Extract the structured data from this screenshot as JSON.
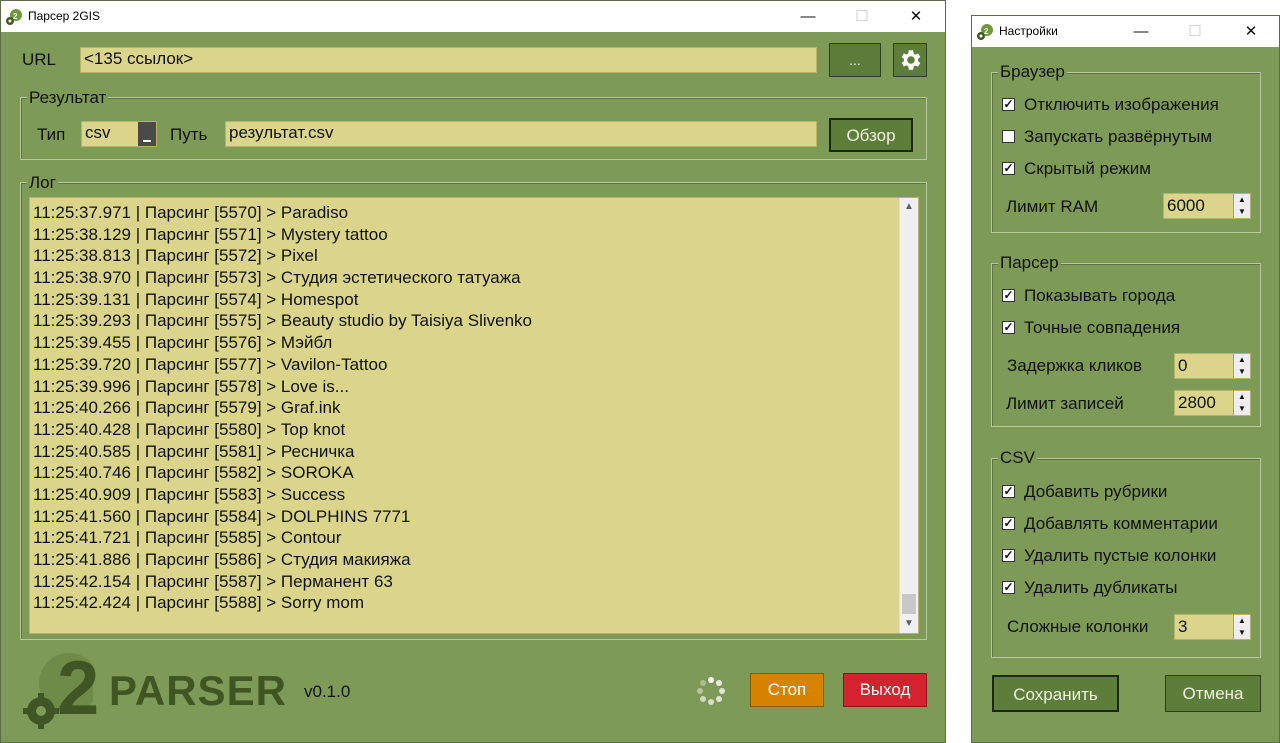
{
  "main_window": {
    "title": "Парсер 2GIS",
    "url_label": "URL",
    "url_value": "<135 ссылок>",
    "browse_urls_label": "...",
    "result_group_title": "Результат",
    "type_label": "Тип",
    "type_value": "csv",
    "path_label": "Путь",
    "path_value": "результат.csv",
    "browse_label": "Обзор",
    "log_group_title": "Лог",
    "log_lines": [
      "11:25:37.971 | Парсинг [5570] > Paradiso",
      "11:25:38.129 | Парсинг [5571] > Mystery tattoo",
      "11:25:38.813 | Парсинг [5572] > Pixel",
      "11:25:38.970 | Парсинг [5573] > Студия эстетического татуажа",
      "11:25:39.131 | Парсинг [5574] > Homespot",
      "11:25:39.293 | Парсинг [5575] > Beauty studio by Taisiya Slivenko",
      "11:25:39.455 | Парсинг [5576] > Мэйбл",
      "11:25:39.720 | Парсинг [5577] > Vavilon-Tattoo",
      "11:25:39.996 | Парсинг [5578] > Love is...",
      "11:25:40.266 | Парсинг [5579] > Graf.ink",
      "11:25:40.428 | Парсинг [5580] > Top knot",
      "11:25:40.585 | Парсинг [5581] > Ресничка",
      "11:25:40.746 | Парсинг [5582] > SOROKA",
      "11:25:40.909 | Парсинг [5583] > Success",
      "11:25:41.560 | Парсинг [5584] > DOLPHINS 7771",
      "11:25:41.721 | Парсинг [5585] > Contour",
      "11:25:41.886 | Парсинг [5586] > Студия макияжа",
      "11:25:42.154 | Парсинг [5587] > Перманент 63",
      "11:25:42.424 | Парсинг [5588] > Sorry mom"
    ],
    "logo_number": "2",
    "logo_text": "PARSER",
    "version": "v0.1.0",
    "stop_label": "Стоп",
    "exit_label": "Выход",
    "colors": {
      "stop": "#d68400",
      "exit": "#d4232e"
    }
  },
  "settings_window": {
    "title": "Настройки",
    "browser_group_title": "Браузер",
    "disable_images_label": "Отключить изображения",
    "disable_images_checked": true,
    "start_maximized_label": "Запускать развёрнутым",
    "start_maximized_checked": false,
    "headless_label": "Скрытый режим",
    "headless_checked": true,
    "ram_limit_label": "Лимит RAM",
    "ram_limit_value": "6000",
    "parser_group_title": "Парсер",
    "show_cities_label": "Показывать города",
    "show_cities_checked": true,
    "exact_match_label": "Точные совпадения",
    "exact_match_checked": true,
    "click_delay_label": "Задержка кликов",
    "click_delay_value": "0",
    "records_limit_label": "Лимит записей",
    "records_limit_value": "2800",
    "csv_group_title": "CSV",
    "add_rubrics_label": "Добавить рубрики",
    "add_rubrics_checked": true,
    "add_comments_label": "Добавлять комментарии",
    "add_comments_checked": true,
    "remove_empty_label": "Удалить пустые колонки",
    "remove_empty_checked": true,
    "remove_duplicates_label": "Удалить дубликаты",
    "remove_duplicates_checked": true,
    "complex_columns_label": "Сложные колонки",
    "complex_columns_value": "3",
    "save_label": "Сохранить",
    "cancel_label": "Отмена"
  }
}
